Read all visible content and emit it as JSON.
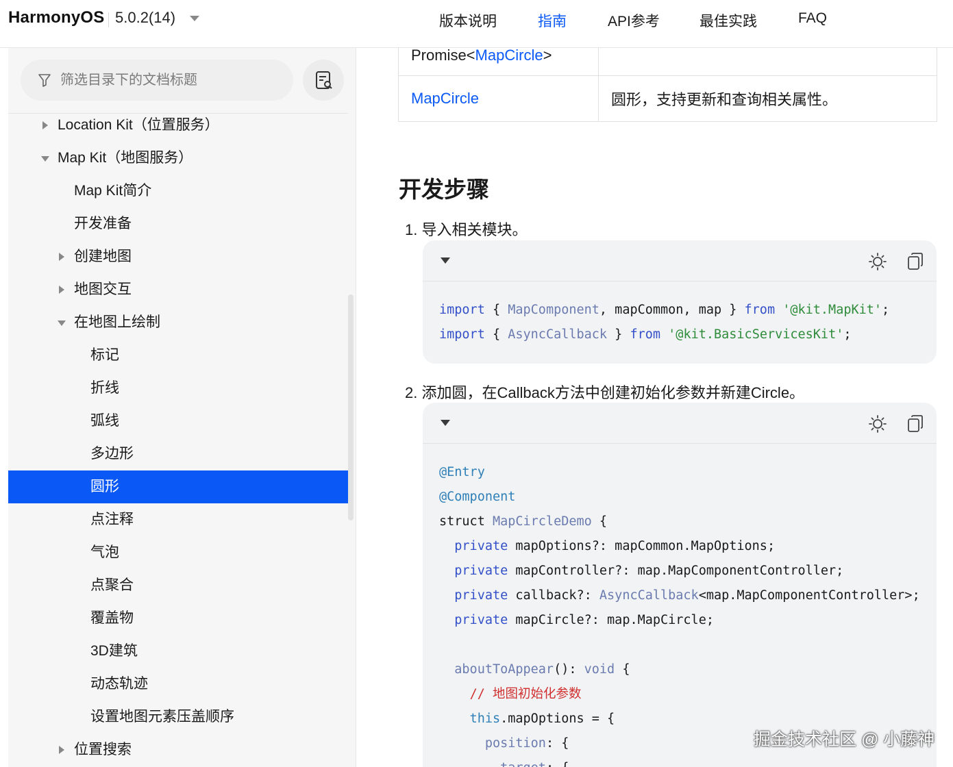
{
  "header": {
    "brand": "HarmonyOS",
    "version": "5.0.2(14)",
    "nav": [
      {
        "label": "版本说明"
      },
      {
        "label": "指南"
      },
      {
        "label": "API参考"
      },
      {
        "label": "最佳实践"
      },
      {
        "label": "FAQ"
      }
    ],
    "active_nav": "指南"
  },
  "sidebar": {
    "filter_placeholder": "筛选目录下的文档标题",
    "items": [
      {
        "label": "Location Kit（位置服务）",
        "toggle": "collapsed"
      },
      {
        "label": "Map Kit（地图服务）",
        "toggle": "expanded"
      },
      {
        "label": "Map Kit简介"
      },
      {
        "label": "开发准备"
      },
      {
        "label": "创建地图",
        "toggle": "collapsed"
      },
      {
        "label": "地图交互",
        "toggle": "collapsed"
      },
      {
        "label": "在地图上绘制",
        "toggle": "expanded"
      },
      {
        "label": "标记"
      },
      {
        "label": "折线"
      },
      {
        "label": "弧线"
      },
      {
        "label": "多边形"
      },
      {
        "label": "圆形",
        "selected": true
      },
      {
        "label": "点注释"
      },
      {
        "label": "气泡"
      },
      {
        "label": "点聚合"
      },
      {
        "label": "覆盖物"
      },
      {
        "label": "3D建筑"
      },
      {
        "label": "动态轨迹"
      },
      {
        "label": "设置地图元素压盖顺序"
      },
      {
        "label": "位置搜索",
        "toggle": "collapsed"
      }
    ]
  },
  "content": {
    "table": {
      "row1": {
        "prefix": "Promise<",
        "link": "MapCircle",
        "suffix": ">"
      },
      "row2": {
        "link": "MapCircle",
        "desc": "圆形，支持更新和查询相关属性。"
      }
    },
    "section_title": "开发步骤",
    "step1": "1. 导入相关模块。",
    "step2": "2. 添加圆，在Callback方法中创建初始化参数并新建Circle。"
  },
  "watermark": "掘金技术社区 @ 小藤神",
  "colors": {
    "accent": "#0a59f7",
    "sidebar_bg": "#f6f6f6",
    "code_bg": "#f1f3f5"
  }
}
